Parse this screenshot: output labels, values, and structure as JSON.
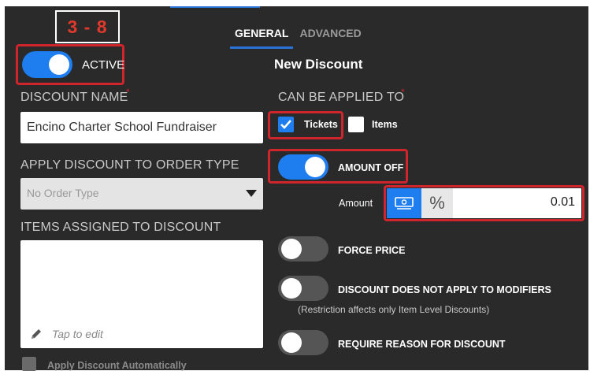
{
  "step_label": "3 - 8",
  "tabs": [
    {
      "label": "GENERAL",
      "active": true
    },
    {
      "label": "ADVANCED",
      "active": false
    }
  ],
  "left": {
    "active_toggle": {
      "label": "ACTIVE",
      "on": true
    },
    "discount_name": {
      "label": "DISCOUNT NAME",
      "value": "Encino Charter School Fundraiser"
    },
    "order_type": {
      "label": "APPLY DISCOUNT TO ORDER TYPE",
      "value": "No Order Type"
    },
    "items_assigned": {
      "label": "ITEMS ASSIGNED TO DISCOUNT",
      "placeholder": "Tap to edit"
    },
    "apply_auto": {
      "label": "Apply Discount Automatically",
      "checked": false
    }
  },
  "right": {
    "title": "New Discount",
    "applied_to": {
      "label": "CAN BE APPLIED TO",
      "options": [
        {
          "label": "Tickets",
          "checked": true
        },
        {
          "label": "Items",
          "checked": false
        }
      ]
    },
    "amount_off": {
      "label": "AMOUNT OFF",
      "on": true
    },
    "amount": {
      "label": "Amount",
      "value": "0.01",
      "percent_symbol": "%"
    },
    "force_price": {
      "label": "FORCE PRICE",
      "on": false
    },
    "modifiers": {
      "label": "DISCOUNT DOES NOT APPLY TO MODIFIERS",
      "note": "(Restriction affects only Item Level Discounts)",
      "on": false
    },
    "require_reason": {
      "label": "REQUIRE REASON FOR DISCOUNT",
      "on": false
    }
  },
  "colors": {
    "accent": "#1e7ef0",
    "highlight": "#d0252c",
    "background": "#2a2a2a"
  }
}
